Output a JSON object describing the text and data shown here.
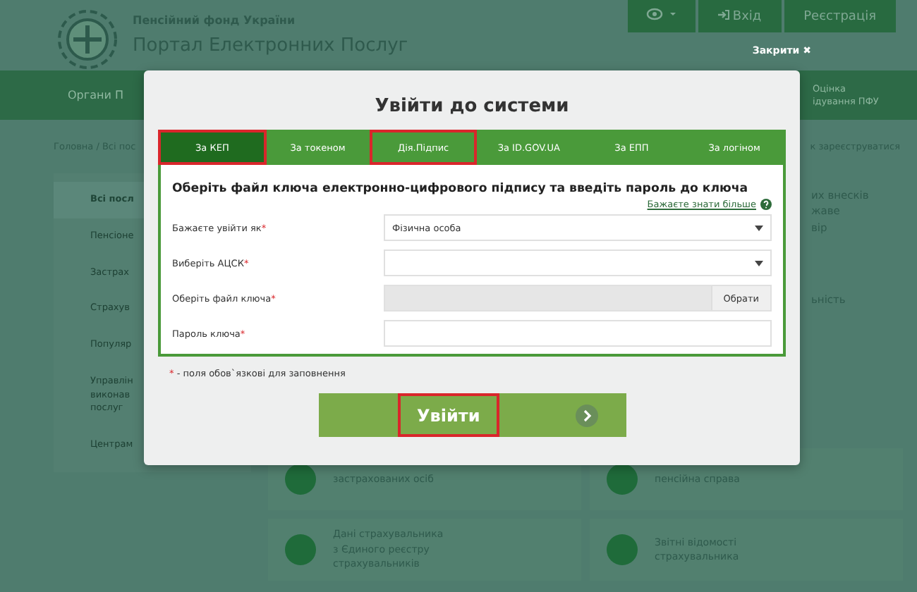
{
  "header": {
    "org": "Пенсійний фонд України",
    "portal": "Портал Електронних Послуг",
    "login": "Вхід",
    "register": "Реєстрація",
    "close": "Закрити ✖"
  },
  "nav": {
    "left": "Органи П",
    "right": [
      "Оцінка",
      "ідування ПФУ"
    ]
  },
  "breadcrumb": {
    "left": "Головна / Всі пос",
    "right": "к зареєструватися"
  },
  "sidebar": {
    "items": [
      {
        "label": "Всі посл",
        "selected": true
      },
      {
        "label": "Пенсіоне",
        "selected": false
      },
      {
        "label": "Застрах",
        "selected": false
      },
      {
        "label": "Страхув",
        "selected": false
      },
      {
        "label": "Популяр",
        "selected": false
      },
      {
        "label": "Управлін\nвиконав\nпослуг",
        "selected": false
      },
      {
        "label": "Центрам",
        "selected": false
      }
    ]
  },
  "right_column": [
    "их внесків\nжаве\nвір",
    "ьність"
  ],
  "cards": [
    {
      "label": "застрахованих осіб"
    },
    {
      "label": "пенсійна справа"
    },
    {
      "label": "Дані страхувальника\nз Єдиного реєстру\nстрахувальників"
    },
    {
      "label": "Звітні відомості\nстрахувальника"
    }
  ],
  "modal": {
    "title": "Увійти до системи",
    "tabs": [
      {
        "label": "За КЕП",
        "selected": true,
        "highlighted": true
      },
      {
        "label": "За токеном",
        "selected": false,
        "highlighted": false
      },
      {
        "label": "Дія.Підпис",
        "selected": false,
        "highlighted": true
      },
      {
        "label": "За ID.GOV.UA",
        "selected": false,
        "highlighted": false
      },
      {
        "label": "За ЕПП",
        "selected": false,
        "highlighted": false
      },
      {
        "label": "За логіном",
        "selected": false,
        "highlighted": false
      }
    ],
    "heading": "Оберіть файл ключа електронно-цифрового підпису та введіть пароль до ключа",
    "more_link": "Бажаєте знати більше",
    "fields": [
      {
        "kind": "select",
        "label": "Бажаєте увійти як",
        "value": "Фізична особа"
      },
      {
        "kind": "select",
        "label": "Виберіть АЦСК"
      },
      {
        "kind": "file",
        "label": "Оберіть файл ключа",
        "button": "Обрати"
      },
      {
        "kind": "text",
        "label": "Пароль ключа"
      }
    ],
    "required_mark": "*",
    "required_note": "- поля обов`язкові для заповнення",
    "submit": {
      "label": "Увійти",
      "highlighted": true
    }
  }
}
